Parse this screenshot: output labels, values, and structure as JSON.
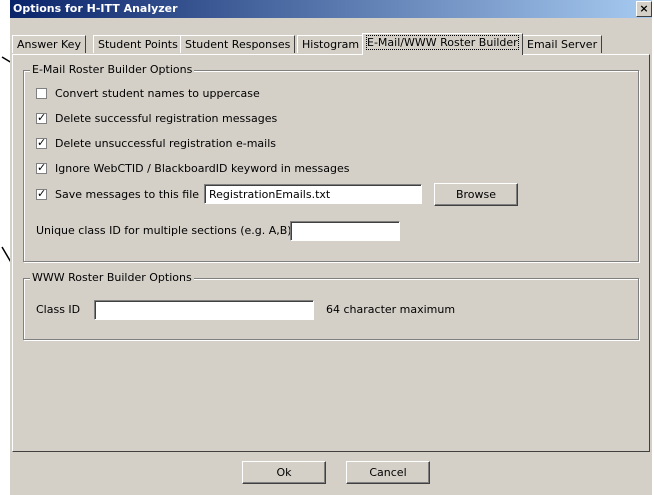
{
  "window": {
    "title": "Options for H-ITT Analyzer",
    "close_glyph": "×"
  },
  "tabs": [
    {
      "label": "Answer Key",
      "active": false
    },
    {
      "label": "Student Points",
      "active": false
    },
    {
      "label": "Student Responses",
      "active": false
    },
    {
      "label": "Histogram",
      "active": false
    },
    {
      "label": "E-Mail/WWW Roster Builder",
      "active": true
    },
    {
      "label": "Email Server",
      "active": false
    }
  ],
  "email_group": {
    "title": "E-Mail Roster Builder Options",
    "options": [
      {
        "label": "Convert student names to uppercase",
        "checked": false
      },
      {
        "label": "Delete successful registration messages",
        "checked": true
      },
      {
        "label": "Delete unsuccessful registration e-mails",
        "checked": true
      },
      {
        "label": "Ignore WebCTID / BlackboardID keyword in messages",
        "checked": true
      },
      {
        "label": "Save messages to this file",
        "checked": true
      }
    ],
    "file_value": "RegistrationEmails.txt",
    "browse_label": "Browse",
    "unique_label": "Unique class ID for multiple sections (e.g. A,B)",
    "unique_value": ""
  },
  "www_group": {
    "title": "WWW Roster Builder Options",
    "class_id_label": "Class ID",
    "class_id_value": "",
    "max_note": "64 character maximum"
  },
  "footer": {
    "ok_label": "Ok",
    "cancel_label": "Cancel"
  },
  "check_glyph": "✓"
}
